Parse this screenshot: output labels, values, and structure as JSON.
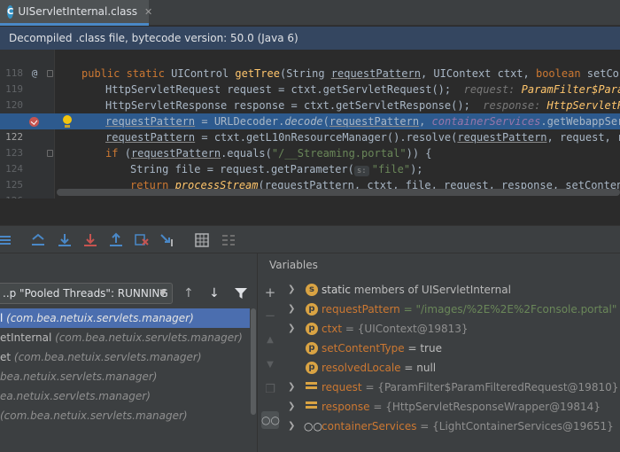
{
  "tab": {
    "title": "UIServletInternal.class",
    "icon": "class-c-icon"
  },
  "banner": {
    "text": "Decompiled .class file, bytecode version: 50.0 (Java 6)"
  },
  "editor": {
    "lines": [
      {
        "num": "118"
      },
      {
        "num": "119",
        "seg": [
          "public static ",
          "UIControl ",
          "getTree",
          "(String ",
          "requestPattern",
          ", UIContext ctxt, ",
          "boolean ",
          "setConten"
        ]
      },
      {
        "num": "120",
        "seg": [
          "HttpServletRequest request = ctxt.getServletRequest();",
          "request: ",
          "ParamFilter$ParamFi"
        ]
      },
      {
        "num": "121",
        "seg": [
          "HttpServletResponse response = ctxt.getServletResponse();",
          "response: ",
          "HttpServletResp"
        ]
      },
      {
        "num": "122",
        "seg": [
          "requestPattern",
          " = URLDecoder.",
          "decode",
          "(",
          "requestPattern",
          ", ",
          "containerServices",
          ".getWebappServic"
        ]
      },
      {
        "num": "123",
        "seg": [
          "requestPattern",
          " = ctxt.getL10nResourceManager().resolve(",
          "requestPattern",
          ", request, reso"
        ]
      },
      {
        "num": "124",
        "seg": [
          "if ",
          "(",
          "requestPattern",
          ".equals(",
          "\"/__Streaming.portal\"",
          ")) {"
        ]
      },
      {
        "num": "125",
        "seg": [
          "String file = request.getParameter(",
          "s:",
          "\"file\"",
          ");"
        ]
      },
      {
        "num": "126",
        "seg": [
          "return ",
          "processStream",
          "(",
          "requestPattern",
          ", ctxt, file, request, response, setContentTy"
        ]
      }
    ]
  },
  "frames": {
    "thread": "..p \"Pooled Threads\": RUNNING",
    "items": [
      {
        "name": "l ",
        "pkg": "(com.bea.netuix.servlets.manager)"
      },
      {
        "name": "etInternal ",
        "pkg": "(com.bea.netuix.servlets.manager)"
      },
      {
        "name": "et ",
        "pkg": "(com.bea.netuix.servlets.manager)"
      },
      {
        "name": "",
        "pkg": "bea.netuix.servlets.manager)"
      },
      {
        "name": "",
        "pkg": "ea.netuix.servlets.manager)"
      },
      {
        "name": "",
        "pkg": "(com.bea.netuix.servlets.manager)"
      },
      {
        "name": "",
        "pkg": ""
      }
    ]
  },
  "variables": {
    "title": "Variables",
    "items": [
      {
        "icon": "s",
        "name": "static",
        "value": " members of UIServletInternal",
        "plainName": true,
        "expand": true
      },
      {
        "icon": "p",
        "name": "requestPattern",
        "value": " = \"/images/%2E%2E%2Fconsole.portal\"",
        "isStr": true,
        "expand": true
      },
      {
        "icon": "p",
        "name": "ctxt",
        "value": " = {UIContext@19813}",
        "ref": true,
        "expand": true
      },
      {
        "icon": "p",
        "name": "setContentType",
        "value": " = true"
      },
      {
        "icon": "p",
        "name": "resolvedLocale",
        "value": " = null"
      },
      {
        "icon": "field",
        "name": "request",
        "value": " = {ParamFilter$ParamFilteredRequest@19810}",
        "ref": true,
        "expand": true
      },
      {
        "icon": "field",
        "name": "response",
        "value": " = {HttpServletResponseWrapper@19814}",
        "ref": true,
        "expand": true
      },
      {
        "icon": "glasses",
        "name": "containerServices",
        "value": " = {LightContainerServices@19651}",
        "ref": true,
        "expand": true
      }
    ]
  },
  "colors": {
    "accent": "#4b6eaf",
    "banner": "#344660",
    "breakpoint": "#c75450",
    "keyword": "#cc7832",
    "string": "#6a8759"
  }
}
